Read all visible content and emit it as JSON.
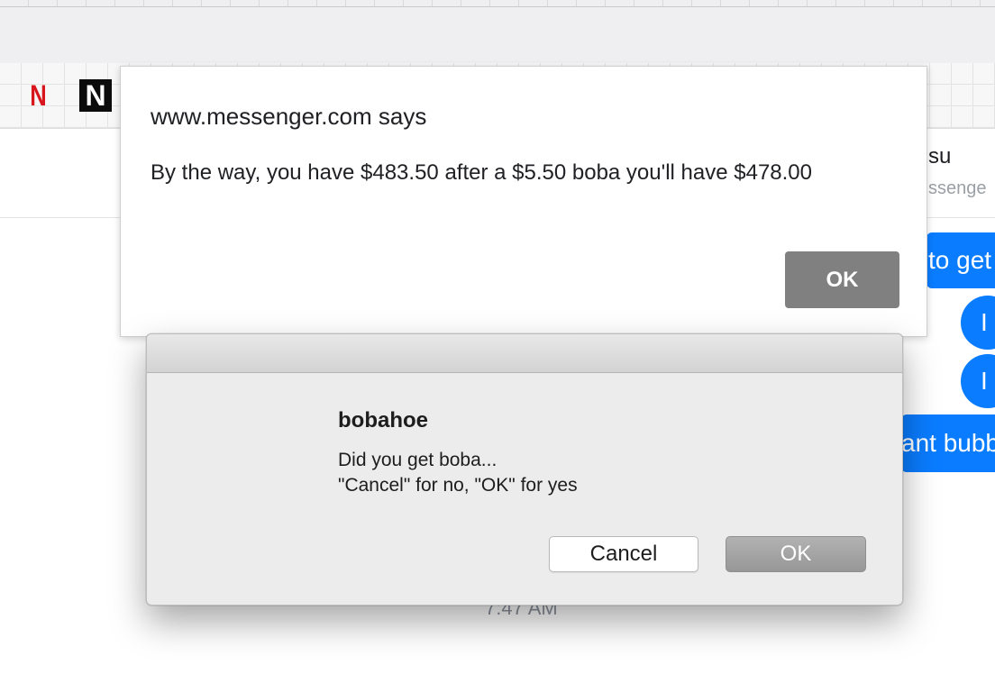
{
  "bookmarks": {
    "netflix_red_letter": "N",
    "netflix_black_letter": "N"
  },
  "chat": {
    "contact_name_fragment": "su",
    "contact_sub_fragment": "ssenge",
    "bubbles": [
      "to get",
      "I",
      "I",
      "ant bubb"
    ],
    "timestamp_fragment": "7:47 AM"
  },
  "alert": {
    "origin": "www.messenger.com says",
    "message": "By the way, you have $483.50 after a $5.50 boba you'll have $478.00",
    "ok_label": "OK"
  },
  "confirm": {
    "title": "bobahoe",
    "message_line1": "Did you get boba...",
    "message_line2": "\"Cancel\" for no, \"OK\" for yes",
    "cancel_label": "Cancel",
    "ok_label": "OK"
  },
  "colors": {
    "messenger_blue": "#0a7cff",
    "alert_ok_gray": "#808080",
    "netflix_red": "#d8141c"
  }
}
